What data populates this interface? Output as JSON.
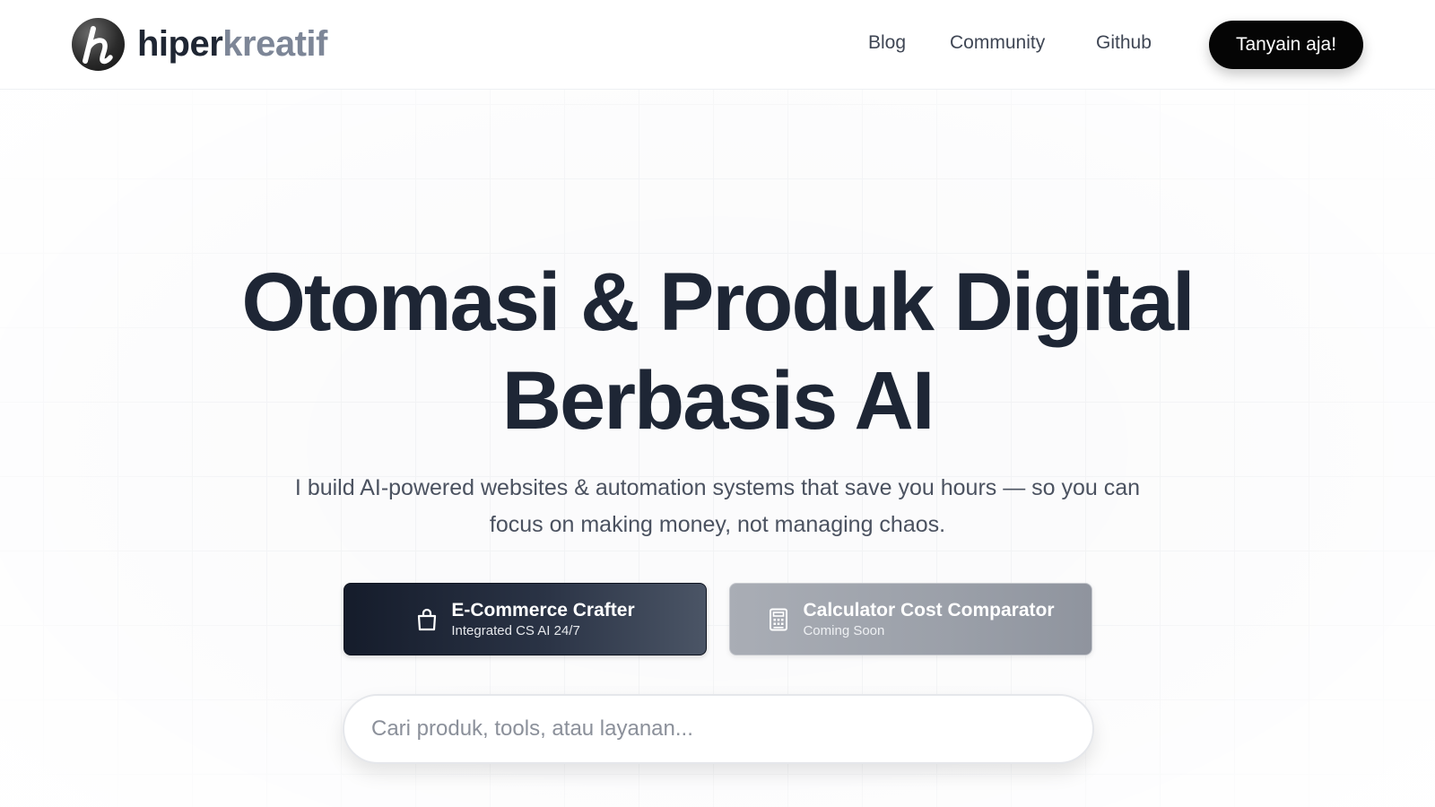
{
  "brand": {
    "name_part1": "hiper",
    "name_part2": "kreatif",
    "logo_icon": "h-logo-icon"
  },
  "nav": {
    "links": [
      "Blog",
      "Community",
      "Github"
    ],
    "cta_label": "Tanyain aja!"
  },
  "hero": {
    "headline_line1": "Otomasi & Produk Digital",
    "headline_line2": "Berbasis AI",
    "subtitle": "I build AI-powered websites & automation systems that save you hours — so you can focus on making money, not managing chaos."
  },
  "cards": [
    {
      "title": "E-Commerce Crafter",
      "subtitle": "Integrated CS AI 24/7",
      "icon": "shopping-bag-icon"
    },
    {
      "title": "Calculator Cost Comparator",
      "subtitle": "Coming Soon",
      "icon": "calculator-icon"
    }
  ],
  "search": {
    "placeholder": "Cari produk, tools, atau layanan..."
  },
  "colors": {
    "text_dark": "#1e2635",
    "cta_bg": "#050505",
    "brand_gray": "#7d8697"
  }
}
